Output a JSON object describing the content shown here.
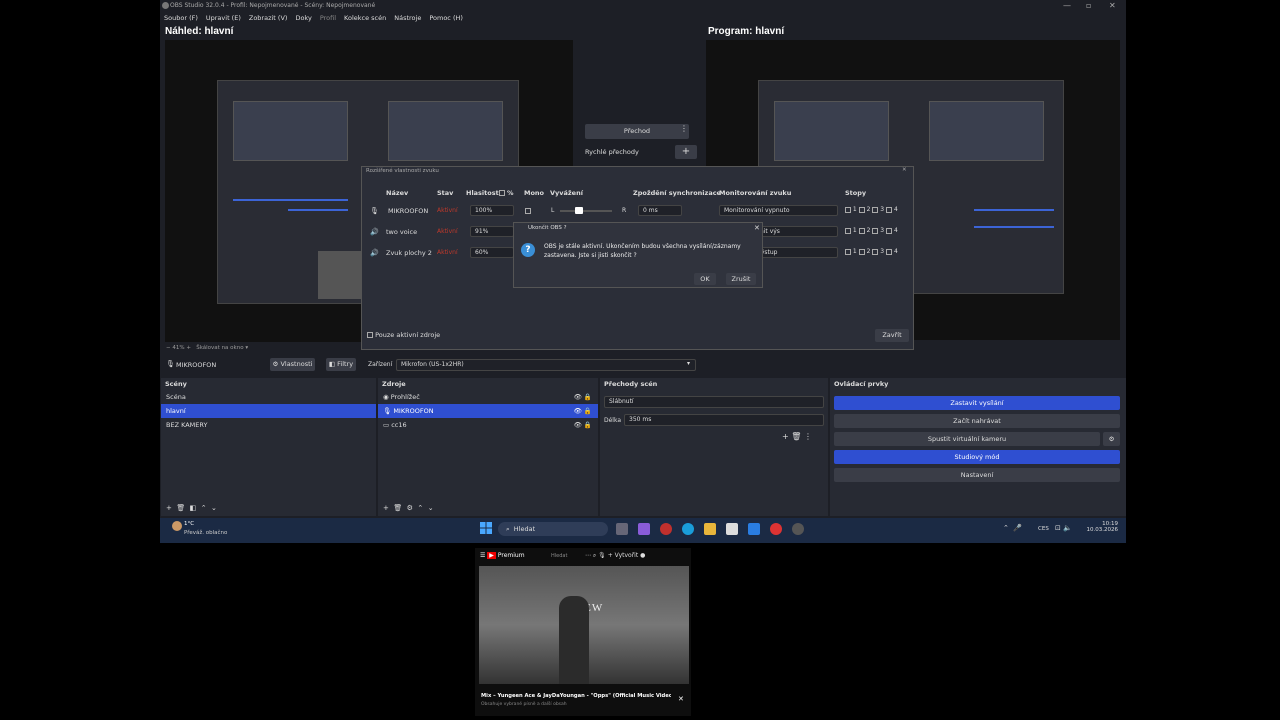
{
  "window": {
    "title": "OBS Studio 32.0.4 - Profil: Nepojmenované - Scény: Nepojmenované"
  },
  "menu": [
    "Soubor (F)",
    "Upravit (E)",
    "Zobrazit (V)",
    "Doky",
    "Profil",
    "Kolekce scén",
    "Nástroje",
    "Pomoc (H)"
  ],
  "preview": {
    "label": "Náhled: hlavní"
  },
  "program": {
    "label": "Program: hlavní"
  },
  "transition": {
    "button": "Přechod",
    "quick": "Rychlé přechody"
  },
  "audio_dialog": {
    "title": "Rozšířené vlastnosti zvuku",
    "columns": {
      "name": "Název",
      "state": "Stav",
      "volume": "Hlasitost",
      "percent": "%",
      "mono": "Mono",
      "balance": "Vyvážení",
      "sync": "Zpoždění synchronizace",
      "monitoring": "Monitorování zvuku",
      "tracks": "Stopy"
    },
    "rows": [
      {
        "name": "MIKROOFON",
        "state": "Aktivní",
        "volume": "100%",
        "sync": "0 ms",
        "monitoring": "Monitorování vypnuto"
      },
      {
        "name": "two voice",
        "state": "Aktivní",
        "volume": "91%",
        "monitoring": "rování (ztlumit výs"
      },
      {
        "name": "Zvuk plochy 2",
        "state": "Aktivní",
        "volume": "60%",
        "monitoring": "odeslat na výstup"
      }
    ],
    "balance_left": "L",
    "balance_right": "R",
    "track_numbers": [
      "1",
      "2",
      "3",
      "4"
    ],
    "only_active": "Pouze aktivní zdroje",
    "close": "Zavřít"
  },
  "exit_dialog": {
    "title": "Ukončit OBS ?",
    "message_line1": "OBS je stále aktivní. Ukončením budou všechna vysílání/záznamy",
    "message_line2": "zastavena. Jste si jisti skončit ?",
    "ok": "OK",
    "cancel": "Zrušit"
  },
  "preview_toolbar": {
    "zoom": "−  41%  +",
    "scale": "Škálovat na okno"
  },
  "source_toolbar": {
    "name": "MIKROOFON",
    "properties": "Vlastnosti",
    "filters": "Filtry",
    "device_label": "Zařízení",
    "device": "Mikrofon (US-1x2HR)"
  },
  "scenes": {
    "title": "Scény",
    "items": [
      "Scéna",
      "hlavní",
      "BEZ KAMERY"
    ],
    "selected": 1
  },
  "sources": {
    "title": "Zdroje",
    "items": [
      "Prohlížeč",
      "MIKROOFON",
      "cc16"
    ],
    "selected": 1
  },
  "transitions": {
    "title": "Přechody scén",
    "type": "Slábnutí",
    "duration_label": "Délka",
    "duration": "350 ms"
  },
  "controls": {
    "title": "Ovládací prvky",
    "stop_stream": "Zastavit vysílání",
    "record": "Začít nahrávat",
    "virtual_cam": "Spustit virtuální kameru",
    "studio": "Studiový mód",
    "settings": "Nastavení"
  },
  "taskbar": {
    "weather_temp": "1°C",
    "weather_desc": "Převáž. oblačno",
    "search": "Hledat",
    "lang": "CES",
    "time": "10:19",
    "date": "10.03.2026"
  },
  "mini_player": {
    "brand": "Premium",
    "search": "Hledat",
    "create": "Vytvořit",
    "caption": "SEW",
    "title": "Mix – Yungeen Ace & JayDaYoungan - \"Opps\" (Official Music Video)",
    "subtitle": "Obsahuje vybrané písně a další obsah"
  },
  "colors": {
    "accent": "#2f4fd1",
    "bg": "#1d1f26",
    "panel": "#272a33",
    "state_red": "#c0392b"
  }
}
